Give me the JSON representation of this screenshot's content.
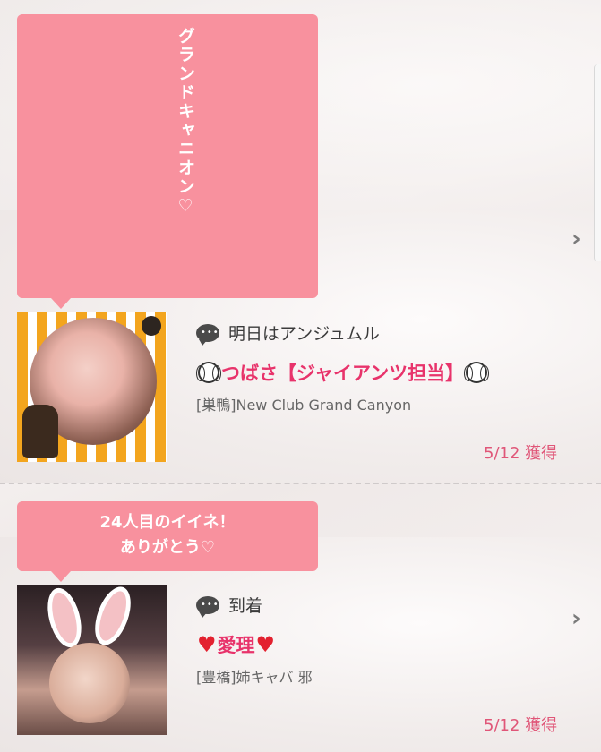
{
  "feed": {
    "posts": [
      {
        "bubble_text": "グランドキャニオン♡",
        "message": "明日はアンジュムル",
        "name": "つばさ【ジャイアンツ担当】",
        "store": "[巣鴨]New Club Grand Canyon",
        "date": "5/12 獲得"
      },
      {
        "bubble_line1": "24人目のイイネ！",
        "bubble_line2": "ありがとう♡",
        "message": "到着",
        "name": "愛理",
        "store": "[豊橋]姉キャバ 邪",
        "date": "5/12 獲得"
      }
    ]
  },
  "icons": {
    "chat": "chat-bubble-icon",
    "chevron": "chevron-right-icon",
    "baseball": "baseball-icon",
    "heart": "heart-icon"
  },
  "colors": {
    "bubble": "#f8919e",
    "name": "#e8336b",
    "date": "#e05678",
    "heart": "#e3212f"
  }
}
